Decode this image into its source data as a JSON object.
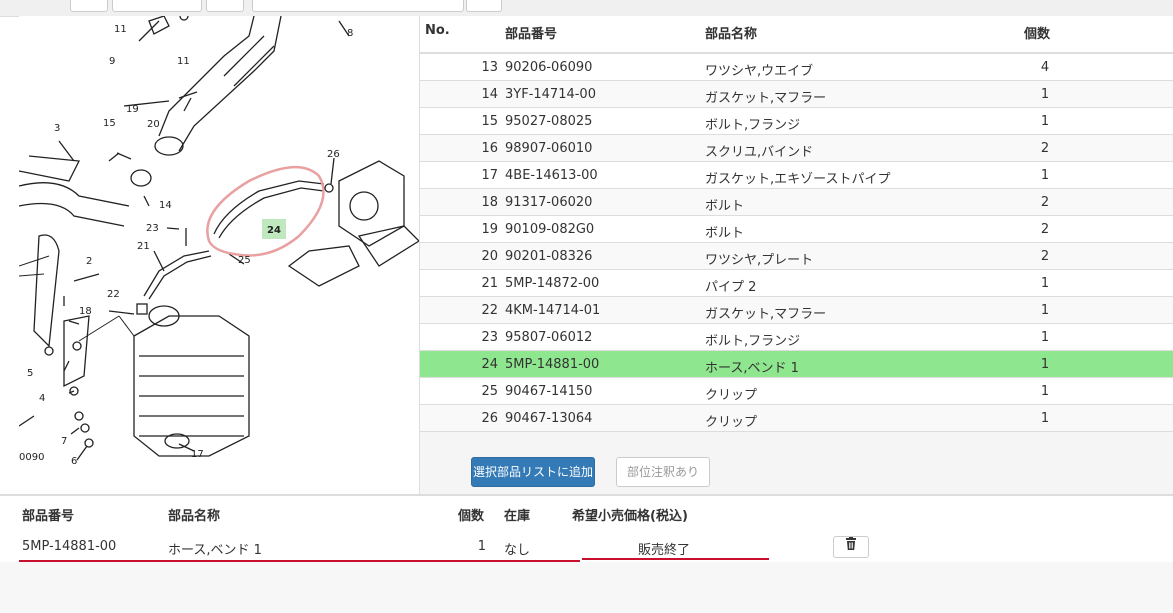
{
  "parts_table": {
    "headers": {
      "no": "No.",
      "part_number": "部品番号",
      "part_name": "部品名称",
      "qty": "個数"
    },
    "rows": [
      {
        "no": "13",
        "part_number": "90206-06090",
        "part_name": "ワツシヤ,ウエイブ",
        "qty": "4"
      },
      {
        "no": "14",
        "part_number": "3YF-14714-00",
        "part_name": "ガスケット,マフラー",
        "qty": "1"
      },
      {
        "no": "15",
        "part_number": "95027-08025",
        "part_name": "ボルト,フランジ",
        "qty": "1"
      },
      {
        "no": "16",
        "part_number": "98907-06010",
        "part_name": "スクリユ,バインド",
        "qty": "2"
      },
      {
        "no": "17",
        "part_number": "4BE-14613-00",
        "part_name": "ガスケット,エキゾーストパイプ",
        "qty": "1"
      },
      {
        "no": "18",
        "part_number": "91317-06020",
        "part_name": "ボルト",
        "qty": "2"
      },
      {
        "no": "19",
        "part_number": "90109-082G0",
        "part_name": "ボルト",
        "qty": "2"
      },
      {
        "no": "20",
        "part_number": "90201-08326",
        "part_name": "ワツシヤ,プレート",
        "qty": "2"
      },
      {
        "no": "21",
        "part_number": "5MP-14872-00",
        "part_name": "パイプ 2",
        "qty": "1"
      },
      {
        "no": "22",
        "part_number": "4KM-14714-01",
        "part_name": "ガスケット,マフラー",
        "qty": "1"
      },
      {
        "no": "23",
        "part_number": "95807-06012",
        "part_name": "ボルト,フランジ",
        "qty": "1"
      },
      {
        "no": "24",
        "part_number": "5MP-14881-00",
        "part_name": "ホース,ベンド 1",
        "qty": "1"
      },
      {
        "no": "25",
        "part_number": "90467-14150",
        "part_name": "クリップ",
        "qty": "1"
      },
      {
        "no": "26",
        "part_number": "90467-13064",
        "part_name": "クリップ",
        "qty": "1"
      }
    ],
    "selected_no": "24"
  },
  "buttons": {
    "add_to_list": "選択部品リストに追加",
    "notes": "部位注釈あり"
  },
  "selected_list": {
    "headers": {
      "part_number": "部品番号",
      "part_name": "部品名称",
      "qty": "個数",
      "stock": "在庫",
      "price": "希望小売価格(税込)"
    },
    "row": {
      "part_number": "5MP-14881-00",
      "part_name": "ホース,ベンド 1",
      "qty": "1",
      "stock": "なし",
      "price": "販売終了"
    }
  },
  "diagram": {
    "labels": [
      "11",
      "11",
      "8",
      "9",
      "19",
      "20",
      "3",
      "15",
      "14",
      "26",
      "24",
      "23",
      "21",
      "25",
      "2",
      "22",
      "18",
      "5",
      "4",
      "7",
      "6",
      "17",
      "0090"
    ],
    "highlight_label": "24",
    "icons": {
      "delete": "trash-icon"
    },
    "colors": {
      "selected_row": "#8ee68e",
      "primary": "#337ab7",
      "highlight_circle": "#e8a0a0",
      "underline": "#c8102e"
    }
  }
}
